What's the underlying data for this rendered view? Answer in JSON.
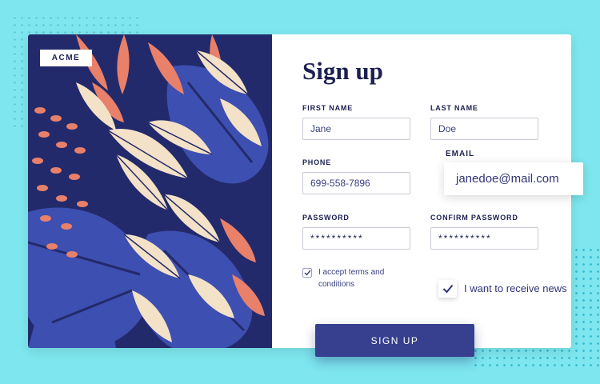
{
  "brand": {
    "logo": "ACME"
  },
  "form": {
    "title": "Sign up",
    "first_name": {
      "label": "FIRST NAME",
      "value": "Jane"
    },
    "last_name": {
      "label": "LAST NAME",
      "value": "Doe"
    },
    "phone": {
      "label": "PHONE",
      "value": "699-558-7896"
    },
    "email": {
      "label": "EMAIL",
      "value": "janedoe@mail.com"
    },
    "password": {
      "label": "PASSWORD",
      "value": "**********"
    },
    "confirm_password": {
      "label": "CONFIRM PASSWORD",
      "value": "**********"
    },
    "terms": {
      "line1": "I accept terms and",
      "line2": "conditions",
      "checked": true
    },
    "newsletter": {
      "label": "I want to receive news",
      "checked": true
    },
    "submit_label": "SIGN UP"
  },
  "colors": {
    "background": "#7de6ee",
    "navy": "#1b2050",
    "button": "#373f8f",
    "art_base": "#232a6b",
    "leaf_coral": "#e8806a",
    "leaf_cream": "#f3e1c8",
    "leaf_blue": "#3d4fb0"
  }
}
